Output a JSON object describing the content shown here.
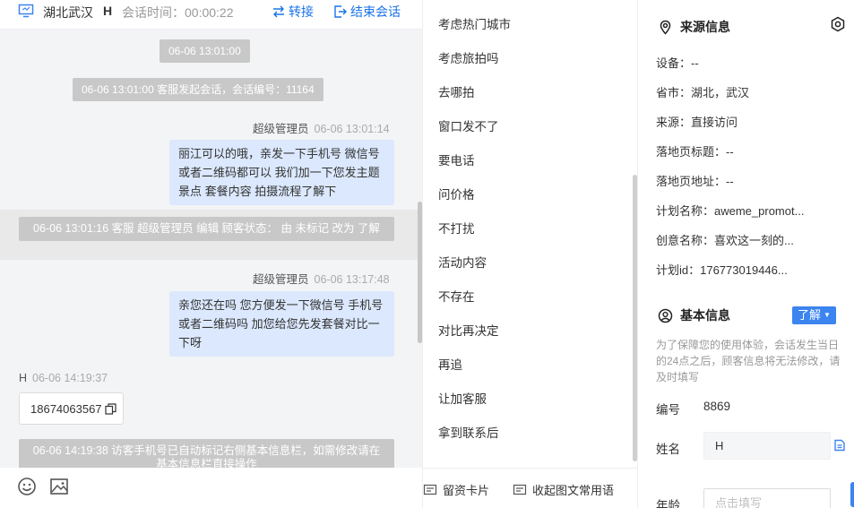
{
  "header": {
    "location": "湖北武汉",
    "visitor": "H",
    "session_time": "会话时间：00:00:22",
    "transfer_label": "转接",
    "end_label": "结束会话"
  },
  "messages": {
    "pill1": "06-06 13:01:00",
    "pill2": "06-06 13:01:00 客服发起会话，会话编号：11164",
    "m1_sender": "超级管理员",
    "m1_time": "06-06 13:01:14",
    "m1_text": "丽江可以的哦，亲发一下手机号 微信号或者二维码都可以 我们加一下您发主题景点 套餐内容 拍摄流程了解下",
    "sys1": "06-06 13:01:16 客服 超级管理员 编辑 顾客状态： 由 未标记 改为 了解",
    "m2_sender": "超级管理员",
    "m2_time": "06-06 13:17:48",
    "m2_text": "亲您还在吗 您方便发一下微信号 手机号或者二维码吗 加您给您先发套餐对比一下呀",
    "m3_sender": "H",
    "m3_time": "06-06 14:19:37",
    "m3_phone": "18674063567",
    "sys2": "06-06 14:19:38 访客手机号已自动标记右侧基本信息栏，如需修改请在基本信息栏直接操作"
  },
  "phrases": [
    "考虑热门城市",
    "考虑旅拍吗",
    "去哪拍",
    "窗口发不了",
    "要电话",
    "问价格",
    "不打扰",
    "活动内容",
    "不存在",
    "对比再决定",
    "再追",
    "让加客服",
    "拿到联系后"
  ],
  "mid_footer": {
    "card_label": "留资卡片",
    "common_label": "收起图文常用语"
  },
  "source": {
    "title": "来源信息",
    "device": "设备：--",
    "region": "省市：湖北，武汉",
    "origin": "来源：直接访问",
    "landing_title": "落地页标题：--",
    "landing_url": "落地页地址：--",
    "plan_name": "计划名称：aweme_promot...",
    "creative_name": "创意名称：喜欢这一刻的...",
    "plan_id": "计划id：176773019446..."
  },
  "basic": {
    "title": "基本信息",
    "status_label": "了解",
    "note": "为了保障您的使用体验，会话发生当日的24点之后，顾客信息将无法修改，请及时填写",
    "id_label": "编号",
    "id_value": "8869",
    "name_label": "姓名",
    "name_value": "H",
    "age_label": "年龄",
    "age_placeholder": "点击填写"
  },
  "colors": {
    "accent": "#3c84f0",
    "bubble": "#dbe8fd",
    "system": "#c8c8c8"
  }
}
